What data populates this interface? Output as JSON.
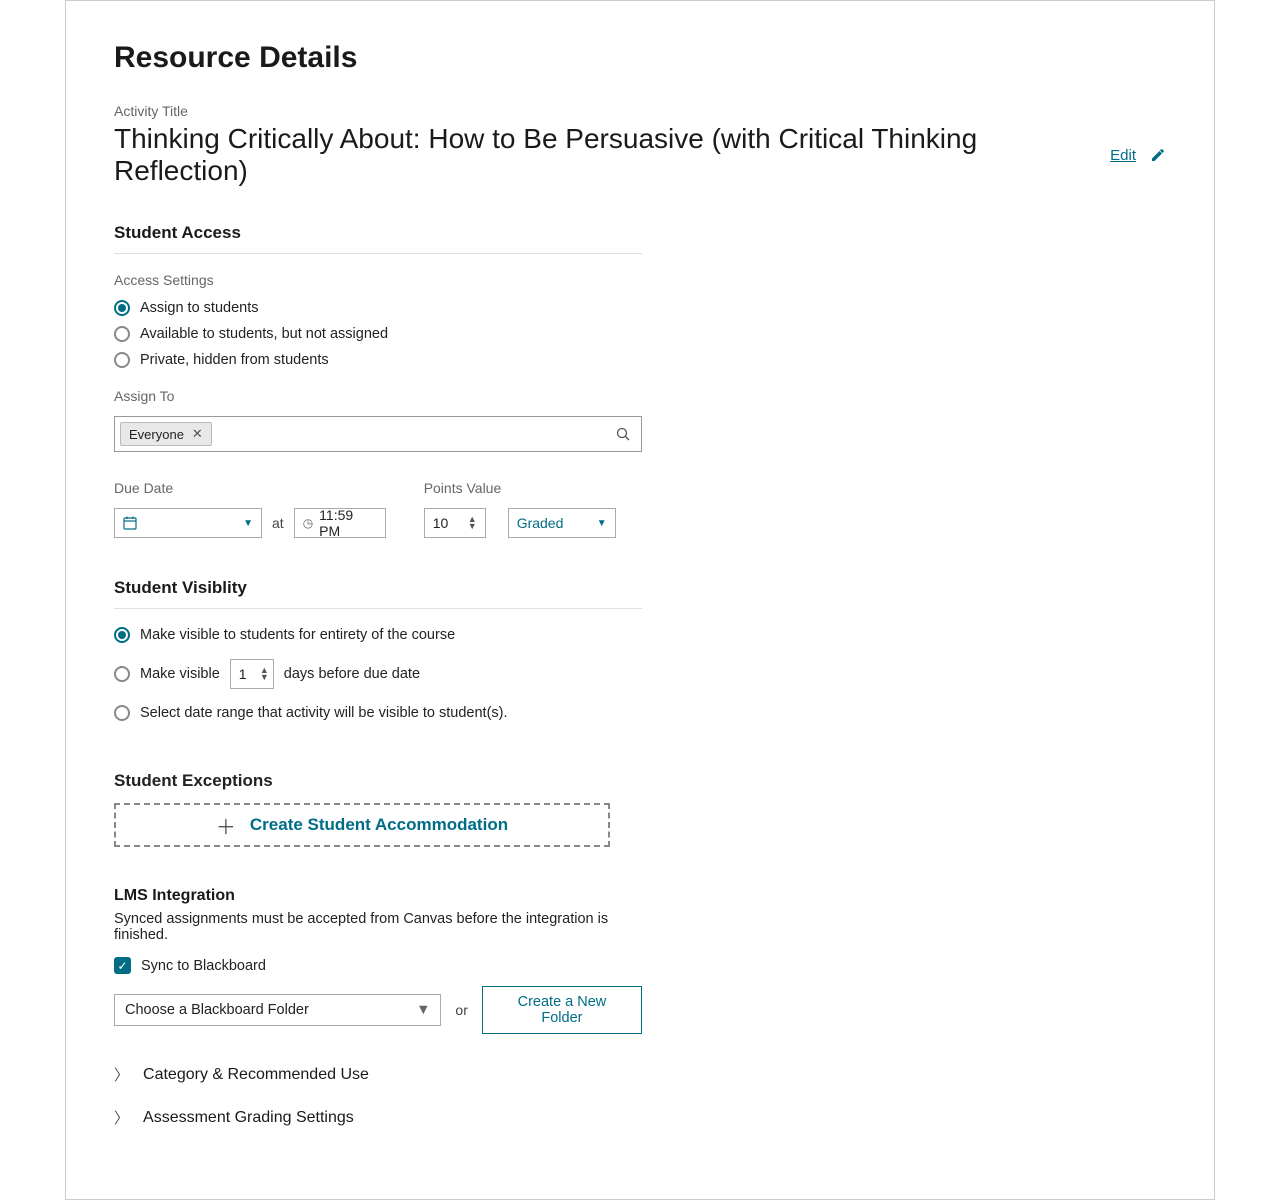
{
  "page": {
    "title": "Resource Details"
  },
  "activity": {
    "label": "Activity Title",
    "title": "Thinking Critically About: How to Be Persuasive (with Critical Thinking Reflection)",
    "edit": "Edit"
  },
  "access": {
    "header": "Student Access",
    "settings_label": "Access Settings",
    "options": [
      "Assign to students",
      "Available to students, but not assigned",
      "Private, hidden from students"
    ],
    "assign_to_label": "Assign To",
    "chip": "Everyone"
  },
  "due": {
    "date_label": "Due Date",
    "at": "at",
    "time": "11:59 PM"
  },
  "points": {
    "label": "Points Value",
    "value": "10",
    "graded": "Graded"
  },
  "visibility": {
    "header": "Student Visiblity",
    "opt1": "Make visible to students for entirety of the course",
    "opt2a": "Make visible",
    "opt2_days": "1",
    "opt2b": "days before due date",
    "opt3": "Select date range that activity will be visible to student(s)."
  },
  "exceptions": {
    "header": "Student Exceptions",
    "create": "Create Student Accommodation"
  },
  "lms": {
    "header": "LMS Integration",
    "desc": "Synced assignments must be accepted from Canvas before the integration is finished.",
    "sync": "Sync to Blackboard",
    "folder_placeholder": "Choose a Blackboard Folder",
    "or": "or",
    "new_folder": "Create a New Folder"
  },
  "expand": {
    "category": "Category & Recommended Use",
    "grading": "Assessment Grading Settings"
  }
}
